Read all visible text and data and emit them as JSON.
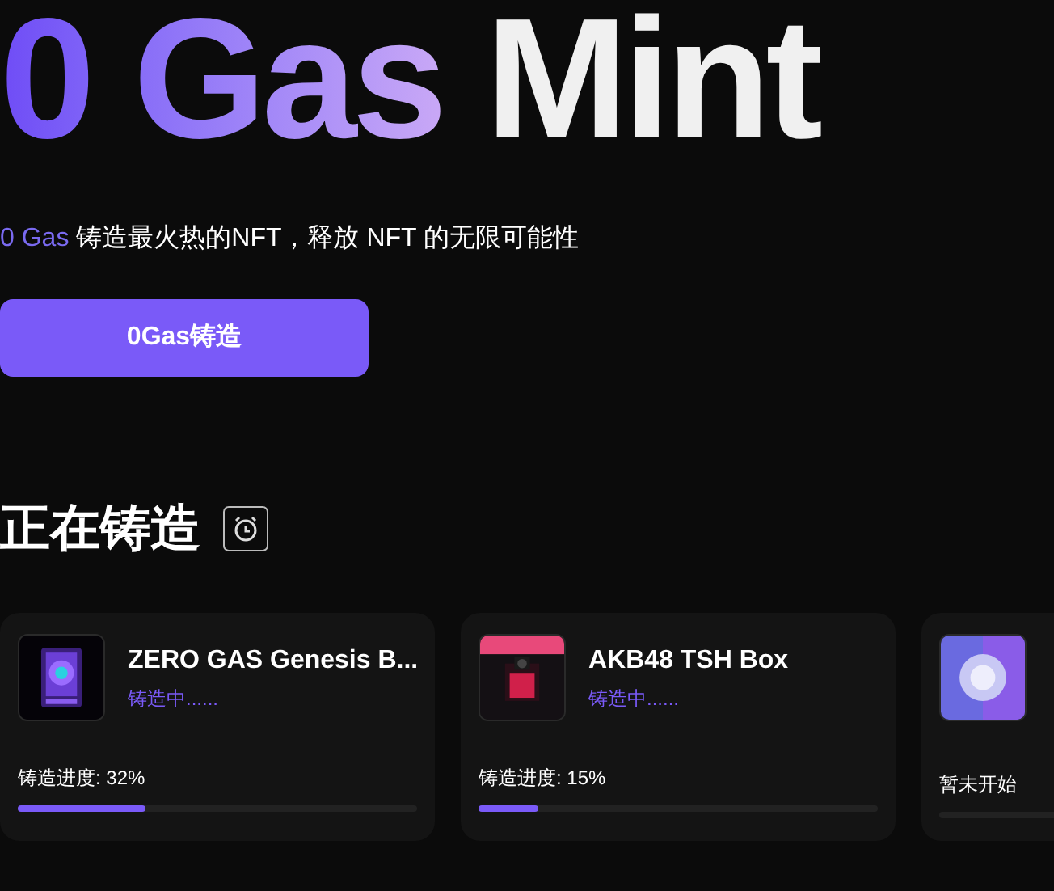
{
  "hero": {
    "title_highlight": "0 Gas",
    "title_rest": "Mint",
    "subtitle_highlight": "0 Gas",
    "subtitle_rest": "铸造最火热的NFT，释放 NFT 的无限可能性",
    "button": "0Gas铸造"
  },
  "section": {
    "title": "正在铸造"
  },
  "cards": [
    {
      "kind": "minting",
      "title": "ZERO GAS Genesis B...",
      "status": "铸造中......",
      "progress_label": "铸造进度: 32%",
      "level": 0.32
    },
    {
      "kind": "minting",
      "title": "AKB48 TSH Box",
      "status": "铸造中......",
      "progress_label": "铸造进度: 15%",
      "level": 0.15
    },
    {
      "kind": "upcoming",
      "status": "暂未开始"
    }
  ]
}
